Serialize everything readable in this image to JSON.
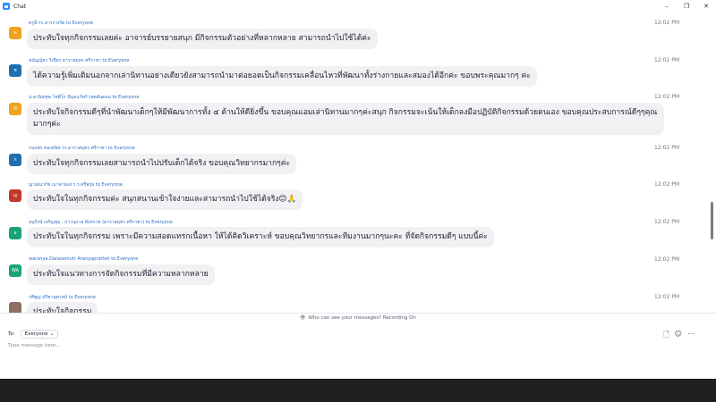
{
  "window": {
    "title": "Chat",
    "controls": [
      "–",
      "❐",
      "✕"
    ]
  },
  "messages": [
    {
      "initial": "ค",
      "avatar_color": "#f0a31c",
      "sender": "ครูนี รร.สารรางรัต",
      "to": "to Everyone",
      "time": "12:02 PM",
      "text": "ประทับใจทุกกิจกรรมเลยค่ะ อาจารย์บรรยายสนุก มีกิจกรรมตัวอย่างที่หลากหลาย สามารถนำไปใช้ได้ค่ะ"
    },
    {
      "initial": "ช",
      "avatar_color": "#1f6fb0",
      "sender": "ชนัญญ์ธร วิเชียร ดาราสมุทร ศรีราชา",
      "to": "to Everyone",
      "time": "12:02 PM",
      "text": "ได้ความรู้เพิ่มเติมนอกจากเล่านิทานอย่างเดียวยังสามารถนำมาต่อยอดเป็นกิจกรรมเคลื่อนไหวที่พัฒนาทั้งร่างกายและสมองได้อีกค่ะ ขอบพระคุณมากๆ ค่ะ"
    },
    {
      "initial": "N",
      "avatar_color": "#f0a31c",
      "sender": "น.ส.ปัณฑุษ โชติโก ปัญจแก้ทร์ เขตสันดอน",
      "to": "to Everyone",
      "time": "12:02 PM",
      "text": "ประทับใจกิจกรรมดีๆที่นำพัฒนาเด็กๆให้มีพัฒนาการทั้ง ๔ ด้านให้ดียิ่งขึ้น ขอบคุณแอมเล่านิทานมากๆค่ะสนุก กิจกรรมจะเน้นให้เด็กลงมือปฏิบัติกิจกรรมด้วยตนเอง ขอบคุณประสบการณ์ดีๆๆคุณมากๆค่ะ"
    },
    {
      "initial": "ก",
      "avatar_color": "#1f6fb0",
      "sender": "กนกพร ทองสนิท รร.ดาราสมุทร ศรีราชา",
      "to": "to Everyone",
      "time": "12:02 PM",
      "text": "ประทับใจทุกกิจกรรมเลยสามารถนำไปปรับเด็กได้จริง ขอบคุณวิทยากรมากๆค่ะ"
    },
    {
      "initial": "ญ",
      "avatar_color": "#c0392b",
      "sender": "ญาณนากัช เมาคายอง ร.ร.ศรีพรุ่ย",
      "to": "to Everyone",
      "time": "12:02 PM",
      "text": "ประทับใจในทุกกิจกรรมค่ะ สนุกสนานเข้าใจง่ายและสามารถนำไปใช้ได้จริง😊🙏"
    },
    {
      "initial": "อ",
      "avatar_color": "#1aa37a",
      "sender": "อนุรักษ์ เจริญชุม , ภาวนุกาส สิงหราช (ดาราสมุทร ศรีราชา)",
      "to": "to Everyone",
      "time": "12:02 PM",
      "text": "ประทับใจในทุกกิจกรรม เพราะมีความสอดแทรกเนื้อหา ให้ได้คิดวิเคราะห์ ขอบคุณวิทยากรและทีมงานมากๆนะคะ ที่จัดกิจกรรมดีๆ แบบนี้ค่ะ"
    },
    {
      "initial": "WA",
      "avatar_color": "#1aa37a",
      "sender": "waranya.Darasamutr Aranyaprathet",
      "to": "to Everyone",
      "time": "12:02 PM",
      "text": "ประทับใจแนวทางการจัดกิจกรรมที่มีความหลากหลาย"
    },
    {
      "initial": "",
      "avatar_color": "#8d6e63",
      "sender": "รพีพูญ ปรีชานุศาสน์",
      "to": "to Everyone",
      "time": "12:02 PM",
      "text": "ประทับใจกิจกรรม"
    }
  ],
  "notice": {
    "icon": "👁",
    "text": "Who can see your messages? Recording On"
  },
  "composer": {
    "to_label": "To:",
    "recipient": "Everyone",
    "placeholder": "Type message here..."
  }
}
